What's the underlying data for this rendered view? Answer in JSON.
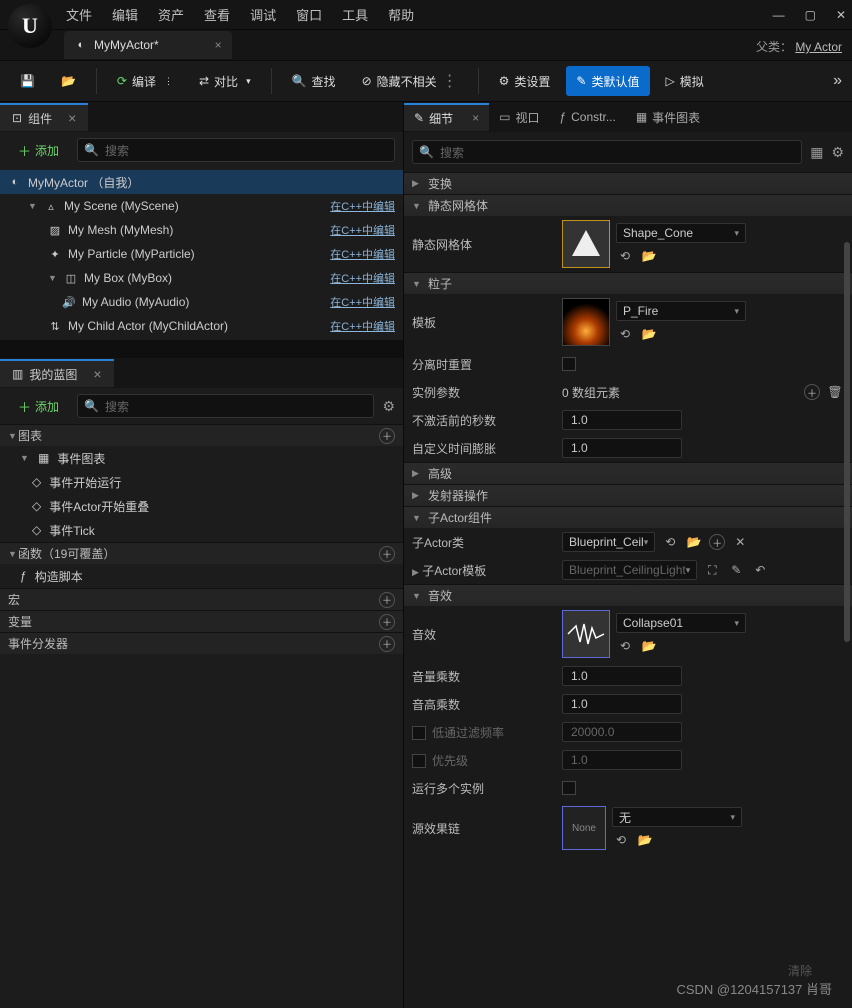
{
  "menu": [
    "文件",
    "编辑",
    "资产",
    "查看",
    "调试",
    "窗口",
    "工具",
    "帮助"
  ],
  "parent": {
    "label": "父类：",
    "value": "My Actor"
  },
  "doc_tab": "MyMyActor*",
  "toolbar": {
    "compile": "编译",
    "diff": "对比",
    "find": "查找",
    "hide": "隐藏不相关",
    "class_settings": "类设置",
    "class_defaults": "类默认值",
    "simulate": "模拟"
  },
  "components": {
    "tab": "组件",
    "add": "添加",
    "search": "搜索",
    "root": "MyMyActor （自我）",
    "items": [
      {
        "label": "My Scene (MyScene)",
        "edit": "在C++中编辑",
        "indent": 1,
        "icon": "▾▴"
      },
      {
        "label": "My Mesh (MyMesh)",
        "edit": "在C++中编辑",
        "indent": 2,
        "icon": "▨"
      },
      {
        "label": "My Particle (MyParticle)",
        "edit": "在C++中编辑",
        "indent": 2,
        "icon": "✦"
      },
      {
        "label": "My Box (MyBox)",
        "edit": "在C++中编辑",
        "indent": 2,
        "icon": "▾◫"
      },
      {
        "label": "My Audio (MyAudio)",
        "edit": "在C++中编辑",
        "indent": 3,
        "icon": "🔊"
      },
      {
        "label": "My Child Actor (MyChildActor)",
        "edit": "在C++中编辑",
        "indent": 2,
        "icon": "⇅"
      }
    ]
  },
  "blueprint": {
    "tab": "我的蓝图",
    "add": "添加",
    "search": "搜索",
    "sections": {
      "graphs": "图表",
      "event_graph": "事件图表",
      "events": [
        "事件开始运行",
        "事件Actor开始重叠",
        "事件Tick"
      ],
      "functions": "函数（19可覆盖）",
      "construct": "构造脚本",
      "macros": "宏",
      "variables": "变量",
      "dispatchers": "事件分发器"
    }
  },
  "right_tabs": {
    "details": "细节",
    "viewport": "视口",
    "construct": "Constr...",
    "eventgraph": "事件图表"
  },
  "details": {
    "search": "搜索",
    "cats": {
      "transform": "变换",
      "static_mesh": "静态网格体",
      "particles": "粒子",
      "advanced": "高级",
      "emitter": "发射器操作",
      "childactor": "子Actor组件",
      "sound": "音效"
    },
    "props": {
      "static_mesh_label": "静态网格体",
      "static_mesh_val": "Shape_Cone",
      "template_label": "模板",
      "template_val": "P_Fire",
      "reset_on_detach": "分离时重置",
      "instance_params": "实例参数",
      "instance_params_val": "0 数组元素",
      "seconds_before_inactive": "不激活前的秒数",
      "seconds_val": "1.0",
      "custom_time_dilation": "自定义时间膨胀",
      "dilation_val": "1.0",
      "child_class": "子Actor类",
      "child_class_val": "Blueprint_Ceil",
      "child_template": "子Actor模板",
      "child_template_val": "Blueprint_CeilingLight",
      "sound_label": "音效",
      "sound_val": "Collapse01",
      "volume": "音量乘数",
      "volume_val": "1.0",
      "pitch": "音高乘数",
      "pitch_val": "1.0",
      "lowpass": "低通过滤频率",
      "lowpass_val": "20000.0",
      "priority": "优先级",
      "priority_val": "1.0",
      "multi_instance": "运行多个实例",
      "source_chain": "源效果链",
      "source_chain_val": "无",
      "none": "None"
    }
  },
  "clear": "清除",
  "watermark": "CSDN @1204157137 肖哥"
}
